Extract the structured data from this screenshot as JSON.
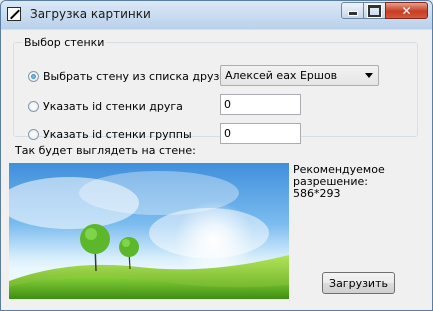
{
  "window": {
    "title": "Загрузка картинки",
    "icon": "pencil-icon",
    "controls": {
      "minimize": "minimize-icon",
      "maximize": "maximize-icon",
      "close": "close-icon"
    }
  },
  "wall_group": {
    "legend": "Выбор стенки",
    "options": [
      {
        "label": "Выбрать стену из списка друзей",
        "checked": true
      },
      {
        "label": "Указать id стенки друга",
        "checked": false
      },
      {
        "label": "Указать id стенки группы",
        "checked": false
      }
    ],
    "friend_select": {
      "selected": "Алексей еах Ершов"
    },
    "friend_id_input": {
      "value": "0"
    },
    "group_id_input": {
      "value": "0"
    }
  },
  "preview": {
    "label": "Так будет выглядеть на стене:",
    "image": "green-hills-wallpaper",
    "recommended_lines": [
      "Рекомендуемое",
      "разрешение:",
      "586*293"
    ]
  },
  "actions": {
    "upload": "Загрузить"
  },
  "colors": {
    "sky_top": "#3f8fdc",
    "hill": "#6cbf2a",
    "title_bar": "#c9dcef",
    "close_button": "#c73e24"
  }
}
